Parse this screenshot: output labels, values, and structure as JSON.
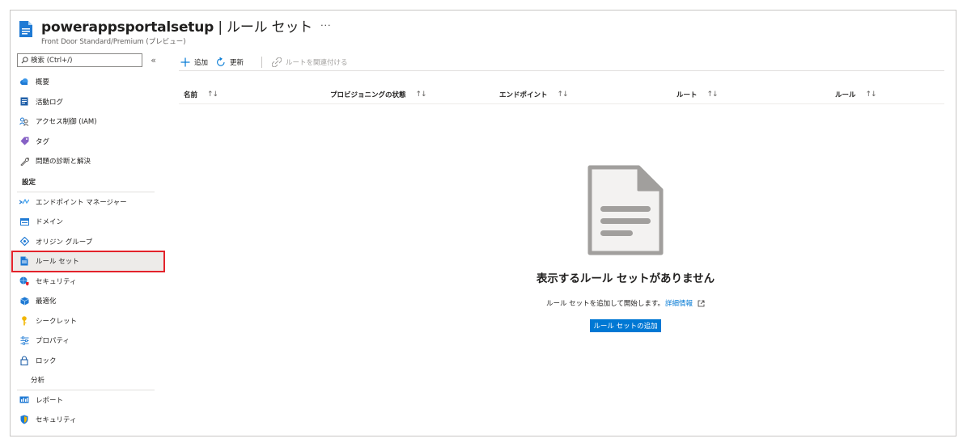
{
  "header": {
    "title_resource": "powerappsportalsetup",
    "title_separator": " | ",
    "title_page": "ルール セット",
    "more_label": "···",
    "subtitle": "Front Door Standard/Premium (プレビュー)",
    "resource_icon": "document-icon"
  },
  "sidebar": {
    "search_placeholder": "検索 (Ctrl+/)",
    "collapse_label": "«",
    "top_items": [
      {
        "label": "概要",
        "icon": "cloud-icon"
      },
      {
        "label": "活動ログ",
        "icon": "activity-log-icon"
      },
      {
        "label": "アクセス制御 (IAM)",
        "icon": "people-icon"
      },
      {
        "label": "タグ",
        "icon": "tag-icon"
      },
      {
        "label": "問題の診断と解決",
        "icon": "wrench-icon"
      }
    ],
    "settings_header": "設定",
    "settings_items": [
      {
        "label": "エンドポイント マネージャー",
        "icon": "endpoint-icon"
      },
      {
        "label": "ドメイン",
        "icon": "domain-icon"
      },
      {
        "label": "オリジン グループ",
        "icon": "origin-icon"
      },
      {
        "label": "ルール セット",
        "icon": "ruleset-icon",
        "selected": true
      },
      {
        "label": "セキュリティ",
        "icon": "security-globe-icon"
      },
      {
        "label": "最適化",
        "icon": "cube-icon"
      },
      {
        "label": "シークレット",
        "icon": "key-icon"
      },
      {
        "label": "プロパティ",
        "icon": "sliders-icon"
      },
      {
        "label": "ロック",
        "icon": "lock-icon"
      }
    ],
    "analytics_header": "分析",
    "analytics_items": [
      {
        "label": "レポート",
        "icon": "report-icon"
      },
      {
        "label": "セキュリティ",
        "icon": "shield-icon"
      }
    ]
  },
  "toolbar": {
    "add_label": "追加",
    "refresh_label": "更新",
    "associate_label": "ルートを関連付ける"
  },
  "table": {
    "columns": [
      "名前",
      "プロビジョニングの状態",
      "エンドポイント",
      "ルート",
      "ルール"
    ],
    "sort_glyph": "↑↓"
  },
  "empty_state": {
    "title": "表示するルール セットがありません",
    "description": "ルール セットを追加して開始します。",
    "link": "詳細情報",
    "button": "ルール セットの追加"
  },
  "colors": {
    "accent": "#0078d4",
    "selected_outline": "#e3232b"
  }
}
